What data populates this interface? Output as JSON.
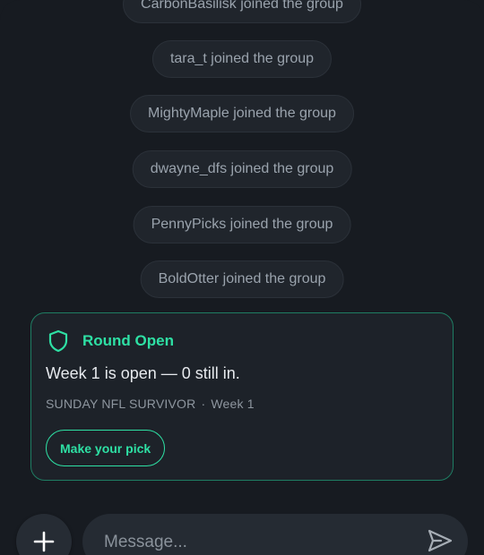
{
  "system_messages": [
    "CarbonBasilisk joined the group",
    "tara_t joined the group",
    "MightyMaple joined the group",
    "dwayne_dfs joined the group",
    "PennyPicks joined the group",
    "BoldOtter joined the group"
  ],
  "round_card": {
    "icon": "shield-icon",
    "title": "Round Open",
    "body": "Week 1 is open — 0 still in.",
    "pool_name": "SUNDAY NFL SURVIVOR",
    "separator": "·",
    "week": "Week 1",
    "cta_label": "Make your pick",
    "accent_color": "#2ee0a4"
  },
  "composer": {
    "add_icon": "plus-icon",
    "placeholder": "Message...",
    "send_icon": "send-icon"
  }
}
